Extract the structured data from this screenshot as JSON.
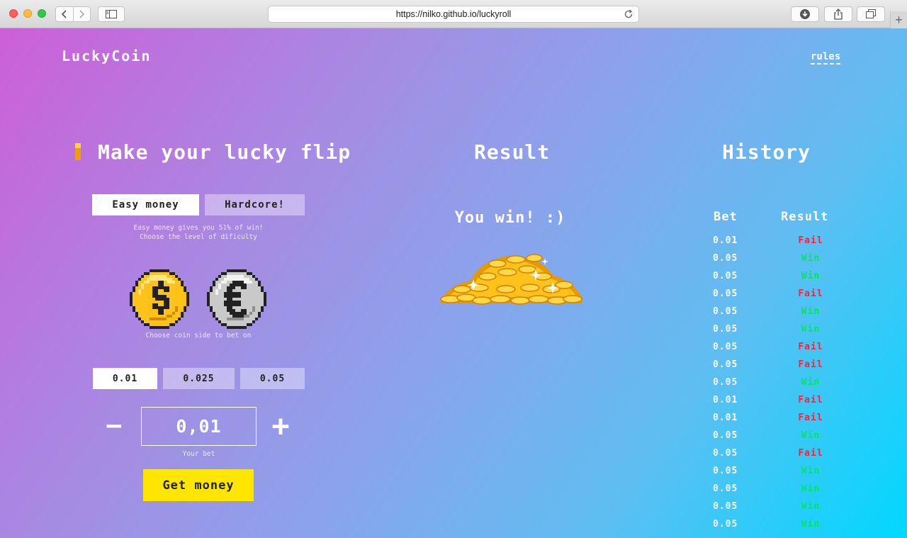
{
  "browser": {
    "url": "https://nilko.github.io/luckyroll",
    "new_tab_label": "+"
  },
  "header": {
    "logo": "LuckyCoin",
    "rules_link": "rules"
  },
  "flip_panel": {
    "title": "Make your lucky flip",
    "modes": [
      "Easy money",
      "Hardcore!"
    ],
    "selected_mode": "Easy money",
    "mode_hint_line1": "Easy money gives you 51% of win!",
    "mode_hint_line2": "Choose the level of dificulty",
    "coin_sides": [
      "dollar-coin-icon",
      "euro-coin-icon"
    ],
    "coin_hint": "Choose coin side to bet on",
    "presets": [
      "0.01",
      "0.025",
      "0.05"
    ],
    "selected_preset": "0.01",
    "minus_label": "−",
    "plus_label": "+",
    "bet_value": "0,01",
    "bet_hint": "Your bet",
    "submit_label": "Get money"
  },
  "result_panel": {
    "title": "Result",
    "message": "You win! :)",
    "image": "gold-coins-pile-icon"
  },
  "history_panel": {
    "title": "History",
    "columns": [
      "Bet",
      "Result"
    ],
    "rows": [
      {
        "bet": "0.01",
        "result": "Fail"
      },
      {
        "bet": "0.05",
        "result": "Win"
      },
      {
        "bet": "0.05",
        "result": "Win"
      },
      {
        "bet": "0.05",
        "result": "Fail"
      },
      {
        "bet": "0.05",
        "result": "Win"
      },
      {
        "bet": "0.05",
        "result": "Win"
      },
      {
        "bet": "0.05",
        "result": "Fail"
      },
      {
        "bet": "0.05",
        "result": "Fail"
      },
      {
        "bet": "0.05",
        "result": "Win"
      },
      {
        "bet": "0.01",
        "result": "Fail"
      },
      {
        "bet": "0.01",
        "result": "Fail"
      },
      {
        "bet": "0.05",
        "result": "Win"
      },
      {
        "bet": "0.05",
        "result": "Fail"
      },
      {
        "bet": "0.05",
        "result": "Win"
      },
      {
        "bet": "0.05",
        "result": "Win"
      },
      {
        "bet": "0.05",
        "result": "Win"
      },
      {
        "bet": "0.05",
        "result": "Win"
      }
    ]
  },
  "colors": {
    "gradient_start": "#cd5fd8",
    "gradient_end": "#00d8ff",
    "cta": "#ffe600",
    "win": "#00e85a",
    "fail": "#ff1f3d"
  }
}
